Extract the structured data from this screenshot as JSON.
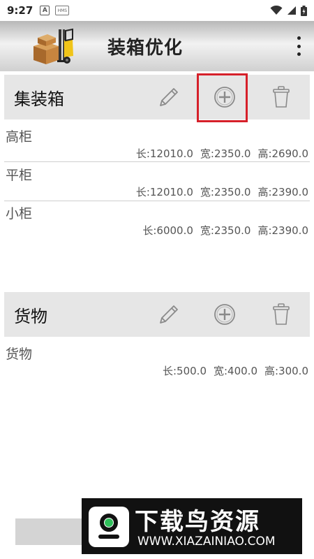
{
  "status_bar": {
    "time": "9:27",
    "notif_letter": "A",
    "hms_label": "HMS"
  },
  "app_bar": {
    "title": "装箱优化",
    "logo_icon": "forklift-icon",
    "menu_icon": "more-vert-icon"
  },
  "containers": {
    "title": "集装箱",
    "items": [
      {
        "name": "高柜",
        "length": "长:12010.0",
        "width": "宽:2350.0",
        "height": "高:2690.0"
      },
      {
        "name": "平柜",
        "length": "长:12010.0",
        "width": "宽:2350.0",
        "height": "高:2390.0"
      },
      {
        "name": "小柜",
        "length": "长:6000.0",
        "width": "宽:2350.0",
        "height": "高:2390.0"
      }
    ]
  },
  "cargo": {
    "title": "货物",
    "items": [
      {
        "name": "货物",
        "length": "长:500.0",
        "width": "宽:400.0",
        "height": "高:300.0"
      }
    ]
  },
  "watermark": {
    "title": "下载鸟资源",
    "url": "WWW.XIAZAINIAO.COM"
  },
  "colors": {
    "highlight": "#d6202a",
    "header_bg": "#e6e6e6",
    "icon_gray": "#8a8a8a",
    "logo_green": "#2fbf5a"
  }
}
